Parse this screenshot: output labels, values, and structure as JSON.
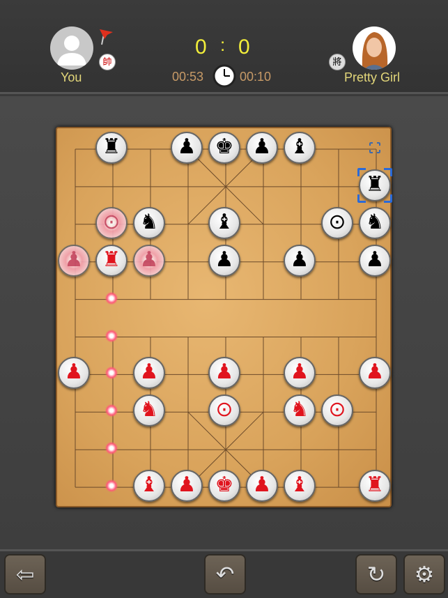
{
  "player": {
    "name": "You",
    "badge": "帥",
    "avatar": "default-user-avatar"
  },
  "opponent": {
    "name": "Pretty Girl",
    "badge": "將",
    "avatar": "girl-avatar"
  },
  "score": {
    "left": "0",
    "sep": ":",
    "right": "0"
  },
  "timers": {
    "player": "00:53",
    "opponent": "00:10"
  },
  "colors": {
    "red": "#e0141e",
    "black": "#000000",
    "score": "#f2ee3a",
    "name": "#e3d77a",
    "timer": "#c79a67",
    "selection": "#2a6ad8"
  },
  "glyphs": {
    "rook": "♜",
    "horse": "♞",
    "elephant": "♝",
    "advisor": "♟",
    "king": "♚",
    "cannon": "⊙",
    "pawn": "♟"
  },
  "pieces": [
    {
      "side": "black",
      "type": "rook",
      "col": 1,
      "row": 0
    },
    {
      "side": "black",
      "type": "advisor",
      "col": 3,
      "row": 0
    },
    {
      "side": "black",
      "type": "king",
      "col": 4,
      "row": 0
    },
    {
      "side": "black",
      "type": "advisor",
      "col": 5,
      "row": 0
    },
    {
      "side": "black",
      "type": "elephant",
      "col": 6,
      "row": 0
    },
    {
      "side": "black",
      "type": "rook",
      "col": 8,
      "row": 1
    },
    {
      "side": "red",
      "type": "cannon",
      "col": 1,
      "row": 2,
      "ghost": true
    },
    {
      "side": "black",
      "type": "horse",
      "col": 2,
      "row": 2
    },
    {
      "side": "black",
      "type": "elephant",
      "col": 4,
      "row": 2
    },
    {
      "side": "black",
      "type": "cannon",
      "col": 7,
      "row": 2
    },
    {
      "side": "black",
      "type": "horse",
      "col": 8,
      "row": 2
    },
    {
      "side": "red",
      "type": "pawn",
      "col": 0,
      "row": 3,
      "ghost": true
    },
    {
      "side": "red",
      "type": "rook",
      "col": 1,
      "row": 3
    },
    {
      "side": "red",
      "type": "pawn",
      "col": 2,
      "row": 3,
      "ghost": true
    },
    {
      "side": "black",
      "type": "pawn",
      "col": 4,
      "row": 3
    },
    {
      "side": "black",
      "type": "pawn",
      "col": 6,
      "row": 3
    },
    {
      "side": "black",
      "type": "pawn",
      "col": 8,
      "row": 3
    },
    {
      "side": "red",
      "type": "pawn",
      "col": 0,
      "row": 6
    },
    {
      "side": "red",
      "type": "pawn",
      "col": 2,
      "row": 6
    },
    {
      "side": "red",
      "type": "pawn",
      "col": 4,
      "row": 6
    },
    {
      "side": "red",
      "type": "pawn",
      "col": 6,
      "row": 6
    },
    {
      "side": "red",
      "type": "pawn",
      "col": 8,
      "row": 6
    },
    {
      "side": "red",
      "type": "horse",
      "col": 2,
      "row": 7
    },
    {
      "side": "red",
      "type": "cannon",
      "col": 4,
      "row": 7
    },
    {
      "side": "red",
      "type": "horse",
      "col": 6,
      "row": 7
    },
    {
      "side": "red",
      "type": "cannon",
      "col": 7,
      "row": 7
    },
    {
      "side": "red",
      "type": "elephant",
      "col": 2,
      "row": 9
    },
    {
      "side": "red",
      "type": "advisor",
      "col": 3,
      "row": 9
    },
    {
      "side": "red",
      "type": "king",
      "col": 4,
      "row": 9
    },
    {
      "side": "red",
      "type": "advisor",
      "col": 5,
      "row": 9
    },
    {
      "side": "red",
      "type": "elephant",
      "col": 6,
      "row": 9
    },
    {
      "side": "red",
      "type": "rook",
      "col": 8,
      "row": 9
    }
  ],
  "move_hints": [
    {
      "col": 1,
      "row": 4
    },
    {
      "col": 1,
      "row": 5
    },
    {
      "col": 1,
      "row": 6
    },
    {
      "col": 1,
      "row": 7
    },
    {
      "col": 1,
      "row": 8
    },
    {
      "col": 1,
      "row": 9
    }
  ],
  "last_move": {
    "from": {
      "col": 8,
      "row": 0
    },
    "to": {
      "col": 8,
      "row": 1
    }
  },
  "toolbar": {
    "back": "back-arrow-icon",
    "undo": "undo-icon",
    "restart": "restart-icon",
    "settings": "gear-icon"
  }
}
